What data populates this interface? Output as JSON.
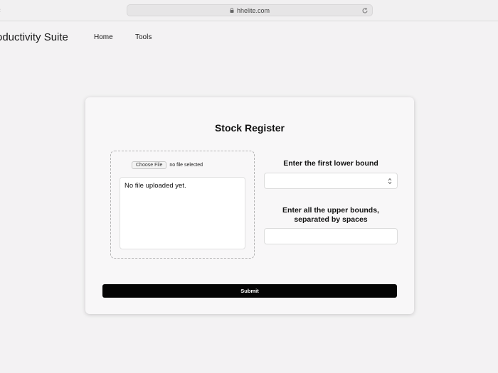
{
  "browser": {
    "url": "hhelite.com"
  },
  "header": {
    "title": "roductivity Suite",
    "nav": [
      {
        "label": "Home"
      },
      {
        "label": "Tools"
      }
    ]
  },
  "form": {
    "title": "Stock Register",
    "file": {
      "button_label": "Choose File",
      "status": "no file selected",
      "preview_text": "No file uploaded yet."
    },
    "lower_bound": {
      "label": "Enter the first lower bound",
      "value": ""
    },
    "upper_bounds": {
      "label_line1": "Enter all the upper bounds,",
      "label_line2": "separated by spaces",
      "value": ""
    },
    "submit_label": "Submit"
  },
  "icons": {
    "lock": "lock-icon",
    "reload": "reload-icon",
    "spinner": "spinner-arrows-icon"
  },
  "colors": {
    "page_bg": "#f3f2f3",
    "card_bg": "#f8f7f8",
    "submit_bg": "#050505",
    "submit_text": "#ffffff"
  }
}
